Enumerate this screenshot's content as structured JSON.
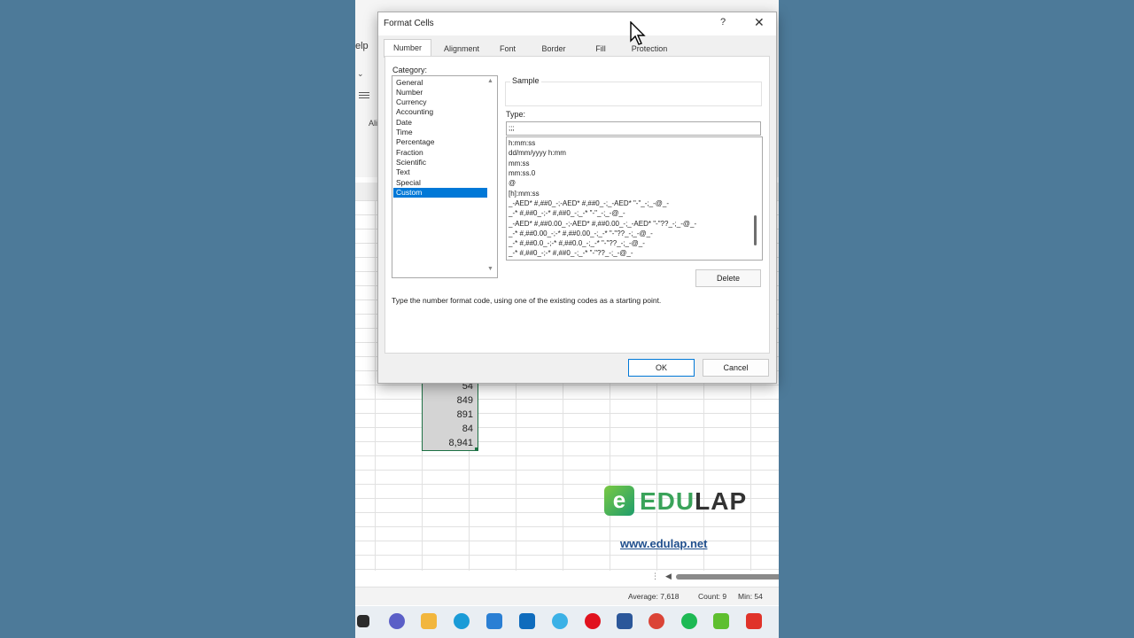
{
  "excel": {
    "menu_help": "elp",
    "align_label": "Ali",
    "cells": [
      "54",
      "849",
      "891",
      "84",
      "8,941"
    ],
    "status": {
      "average": "Average:  7,618",
      "count": "Count: 9",
      "min": "Min:  54"
    }
  },
  "brand": {
    "logo_letter": "e",
    "edu": "EDU",
    "lap": "LAP",
    "url": "www.edulap.net"
  },
  "dialog": {
    "title": "Format Cells",
    "help_glyph": "?",
    "close_glyph": "✕",
    "tabs": [
      "Number",
      "Alignment",
      "Font",
      "Border",
      "Fill",
      "Protection"
    ],
    "active_tab": "Number",
    "category_label": "Category:",
    "categories": [
      "General",
      "Number",
      "Currency",
      "Accounting",
      "Date",
      "Time",
      "Percentage",
      "Fraction",
      "Scientific",
      "Text",
      "Special",
      "Custom"
    ],
    "selected_category": "Custom",
    "sample_label": "Sample",
    "type_label": "Type:",
    "type_value": ";;;",
    "formats": [
      "h:mm:ss",
      "dd/mm/yyyy h:mm",
      "mm:ss",
      "mm:ss.0",
      "@",
      "[h]:mm:ss",
      "_-AED* #,##0_-;-AED* #,##0_-;_-AED* \"-\"_-;_-@_-",
      "_-* #,##0_-;-* #,##0_-;_-* \"-\"_-;_-@_-",
      "_-AED* #,##0.00_-;-AED* #,##0.00_-;_-AED* \"-\"??_-;_-@_-",
      "_-* #,##0.00_-;-* #,##0.00_-;_-* \"-\"??_-;_-@_-",
      "_-* #,##0.0_-;-* #,##0.0_-;_-* \"-\"??_-;_-@_-",
      "_-* #,##0_-;-* #,##0_-;_-* \"-\"??_-;_-@_-"
    ],
    "delete_label": "Delete",
    "hint": "Type the number format code, using one of the existing codes as a starting point.",
    "ok_label": "OK",
    "cancel_label": "Cancel"
  },
  "taskbar": {
    "icons": [
      "file-explorer-icon",
      "teams-icon",
      "folder-icon",
      "edge-icon",
      "store-icon",
      "outlook-icon",
      "paint-icon",
      "opera-icon",
      "word-icon",
      "chrome-icon",
      "spotify-icon",
      "camtasia-icon",
      "recorder-icon"
    ]
  },
  "colors": {
    "accent": "#0078d7",
    "excel_green": "#1e7145",
    "desktop": "#4d7a99"
  }
}
